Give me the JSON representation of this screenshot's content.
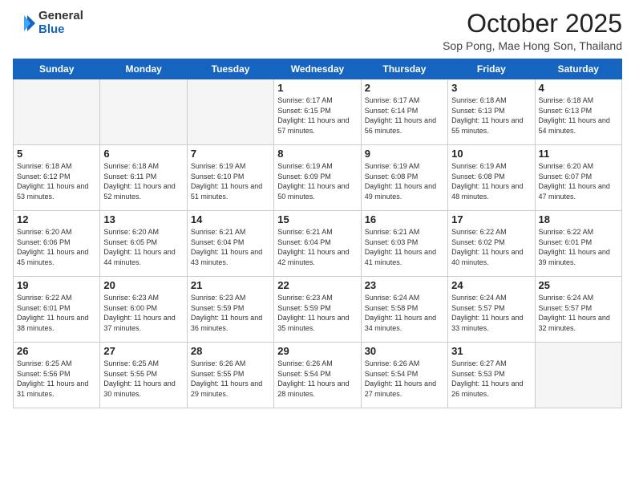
{
  "logo": {
    "general": "General",
    "blue": "Blue"
  },
  "title": "October 2025",
  "subtitle": "Sop Pong, Mae Hong Son, Thailand",
  "days_of_week": [
    "Sunday",
    "Monday",
    "Tuesday",
    "Wednesday",
    "Thursday",
    "Friday",
    "Saturday"
  ],
  "weeks": [
    [
      {
        "day": "",
        "empty": true
      },
      {
        "day": "",
        "empty": true
      },
      {
        "day": "",
        "empty": true
      },
      {
        "day": "1",
        "sunrise": "6:17 AM",
        "sunset": "6:15 PM",
        "daylight": "11 hours and 57 minutes."
      },
      {
        "day": "2",
        "sunrise": "6:17 AM",
        "sunset": "6:14 PM",
        "daylight": "11 hours and 56 minutes."
      },
      {
        "day": "3",
        "sunrise": "6:18 AM",
        "sunset": "6:13 PM",
        "daylight": "11 hours and 55 minutes."
      },
      {
        "day": "4",
        "sunrise": "6:18 AM",
        "sunset": "6:13 PM",
        "daylight": "11 hours and 54 minutes."
      }
    ],
    [
      {
        "day": "5",
        "sunrise": "6:18 AM",
        "sunset": "6:12 PM",
        "daylight": "11 hours and 53 minutes."
      },
      {
        "day": "6",
        "sunrise": "6:18 AM",
        "sunset": "6:11 PM",
        "daylight": "11 hours and 52 minutes."
      },
      {
        "day": "7",
        "sunrise": "6:19 AM",
        "sunset": "6:10 PM",
        "daylight": "11 hours and 51 minutes."
      },
      {
        "day": "8",
        "sunrise": "6:19 AM",
        "sunset": "6:09 PM",
        "daylight": "11 hours and 50 minutes."
      },
      {
        "day": "9",
        "sunrise": "6:19 AM",
        "sunset": "6:08 PM",
        "daylight": "11 hours and 49 minutes."
      },
      {
        "day": "10",
        "sunrise": "6:19 AM",
        "sunset": "6:08 PM",
        "daylight": "11 hours and 48 minutes."
      },
      {
        "day": "11",
        "sunrise": "6:20 AM",
        "sunset": "6:07 PM",
        "daylight": "11 hours and 47 minutes."
      }
    ],
    [
      {
        "day": "12",
        "sunrise": "6:20 AM",
        "sunset": "6:06 PM",
        "daylight": "11 hours and 45 minutes."
      },
      {
        "day": "13",
        "sunrise": "6:20 AM",
        "sunset": "6:05 PM",
        "daylight": "11 hours and 44 minutes."
      },
      {
        "day": "14",
        "sunrise": "6:21 AM",
        "sunset": "6:04 PM",
        "daylight": "11 hours and 43 minutes."
      },
      {
        "day": "15",
        "sunrise": "6:21 AM",
        "sunset": "6:04 PM",
        "daylight": "11 hours and 42 minutes."
      },
      {
        "day": "16",
        "sunrise": "6:21 AM",
        "sunset": "6:03 PM",
        "daylight": "11 hours and 41 minutes."
      },
      {
        "day": "17",
        "sunrise": "6:22 AM",
        "sunset": "6:02 PM",
        "daylight": "11 hours and 40 minutes."
      },
      {
        "day": "18",
        "sunrise": "6:22 AM",
        "sunset": "6:01 PM",
        "daylight": "11 hours and 39 minutes."
      }
    ],
    [
      {
        "day": "19",
        "sunrise": "6:22 AM",
        "sunset": "6:01 PM",
        "daylight": "11 hours and 38 minutes."
      },
      {
        "day": "20",
        "sunrise": "6:23 AM",
        "sunset": "6:00 PM",
        "daylight": "11 hours and 37 minutes."
      },
      {
        "day": "21",
        "sunrise": "6:23 AM",
        "sunset": "5:59 PM",
        "daylight": "11 hours and 36 minutes."
      },
      {
        "day": "22",
        "sunrise": "6:23 AM",
        "sunset": "5:59 PM",
        "daylight": "11 hours and 35 minutes."
      },
      {
        "day": "23",
        "sunrise": "6:24 AM",
        "sunset": "5:58 PM",
        "daylight": "11 hours and 34 minutes."
      },
      {
        "day": "24",
        "sunrise": "6:24 AM",
        "sunset": "5:57 PM",
        "daylight": "11 hours and 33 minutes."
      },
      {
        "day": "25",
        "sunrise": "6:24 AM",
        "sunset": "5:57 PM",
        "daylight": "11 hours and 32 minutes."
      }
    ],
    [
      {
        "day": "26",
        "sunrise": "6:25 AM",
        "sunset": "5:56 PM",
        "daylight": "11 hours and 31 minutes."
      },
      {
        "day": "27",
        "sunrise": "6:25 AM",
        "sunset": "5:55 PM",
        "daylight": "11 hours and 30 minutes."
      },
      {
        "day": "28",
        "sunrise": "6:26 AM",
        "sunset": "5:55 PM",
        "daylight": "11 hours and 29 minutes."
      },
      {
        "day": "29",
        "sunrise": "6:26 AM",
        "sunset": "5:54 PM",
        "daylight": "11 hours and 28 minutes."
      },
      {
        "day": "30",
        "sunrise": "6:26 AM",
        "sunset": "5:54 PM",
        "daylight": "11 hours and 27 minutes."
      },
      {
        "day": "31",
        "sunrise": "6:27 AM",
        "sunset": "5:53 PM",
        "daylight": "11 hours and 26 minutes."
      },
      {
        "day": "",
        "empty": true
      }
    ]
  ],
  "labels": {
    "sunrise": "Sunrise:",
    "sunset": "Sunset:",
    "daylight": "Daylight:"
  }
}
